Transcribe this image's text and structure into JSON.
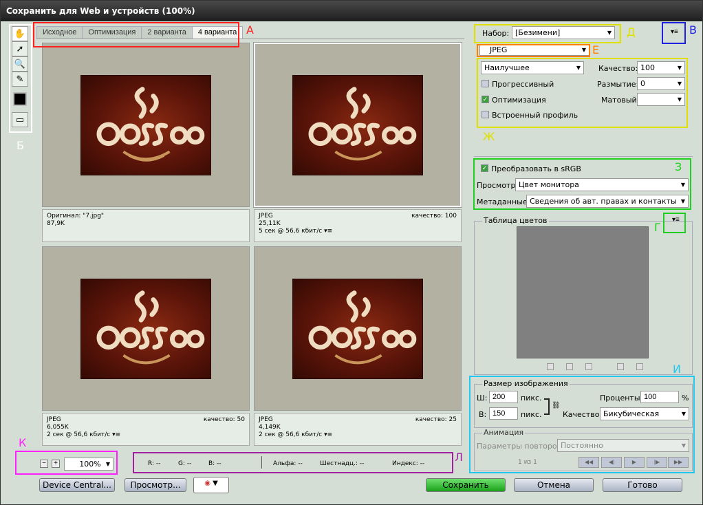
{
  "window": {
    "title": "Сохранить для Web и устройств (100%)"
  },
  "tabs": [
    "Исходное",
    "Оптимизация",
    "2 варианта",
    "4 варианта"
  ],
  "previews": [
    {
      "line1": "Оригинал: \"7.jpg\"",
      "line2": "87,9K",
      "line3": "",
      "quality": ""
    },
    {
      "line1": "JPEG",
      "line2": "25,11K",
      "line3": "5 сек @ 56,6 кбит/с",
      "quality": "качество: 100"
    },
    {
      "line1": "JPEG",
      "line2": "6,055K",
      "line3": "2 сек @ 56,6 кбит/с",
      "quality": "качество: 50"
    },
    {
      "line1": "JPEG",
      "line2": "4,149K",
      "line3": "2 сек @ 56,6 кбит/с",
      "quality": "качество: 25"
    }
  ],
  "settings": {
    "preset_label": "Набор:",
    "preset_value": "[Безимени]",
    "format_value": "JPEG",
    "quality_preset": "Наилучшее",
    "quality_label": "Качество:",
    "quality_value": "100",
    "progressive_label": "Прогрессивный",
    "blur_label": "Размытие:",
    "blur_value": "0",
    "optimized_label": "Оптимизация",
    "matte_label": "Матовый:",
    "matte_value": "",
    "embed_profile_label": "Встроенный профиль",
    "convert_srgb_label": "Преобразовать в sRGB",
    "preview_label": "Просмотр:",
    "preview_value": "Цвет монитора",
    "metadata_label": "Метаданные:",
    "metadata_value": "Сведения об авт. правах и контакты"
  },
  "color_table": {
    "title": "Таблица цветов"
  },
  "image_size": {
    "title": "Размер изображения",
    "w_label": "Ш:",
    "w_value": "200",
    "w_unit": "пикс.",
    "h_label": "В:",
    "h_value": "150",
    "h_unit": "пикс.",
    "percent_label": "Проценты:",
    "percent_value": "100",
    "percent_unit": "%",
    "quality_label": "Качество:",
    "quality_value": "Бикубическая"
  },
  "animation": {
    "title": "Анимация",
    "loop_label": "Параметры повторов:",
    "loop_value": "Постоянно",
    "frame_counter": "1 из 1"
  },
  "zoom": {
    "value": "100%",
    "minus": "−",
    "plus": "+"
  },
  "status": {
    "r": "R: --",
    "g": "G: --",
    "b": "B: --",
    "alpha": "Альфа: --",
    "hex": "Шестнадц.: --",
    "index": "Индекс: --"
  },
  "buttons": {
    "device_central": "Device Central...",
    "preview": "Просмотр...",
    "save": "Сохранить",
    "cancel": "Отмена",
    "done": "Готово"
  },
  "annotations": {
    "a": "А",
    "b": "Б",
    "v": "В",
    "g": "Г",
    "d": "Д",
    "e": "Е",
    "zh": "Ж",
    "z": "З",
    "i": "И",
    "k": "К",
    "l": "Л"
  },
  "colors": {
    "red": "#ff2020",
    "yellow": "#e0e000",
    "blue": "#2020e0",
    "orange": "#ff8000",
    "green": "#20d020",
    "cyan": "#20c8f0",
    "magenta": "#ff20ff",
    "purple": "#a020a0",
    "bg": "#d4ded4",
    "save_green": "#1aa21a"
  },
  "icons": {
    "hand": "hand-icon",
    "slice_select": "slice-select-icon",
    "zoom": "zoom-icon",
    "eyedropper": "eyedropper-icon",
    "color_swatch": "color-swatch-icon",
    "toggle_slices": "toggle-slices-icon"
  }
}
